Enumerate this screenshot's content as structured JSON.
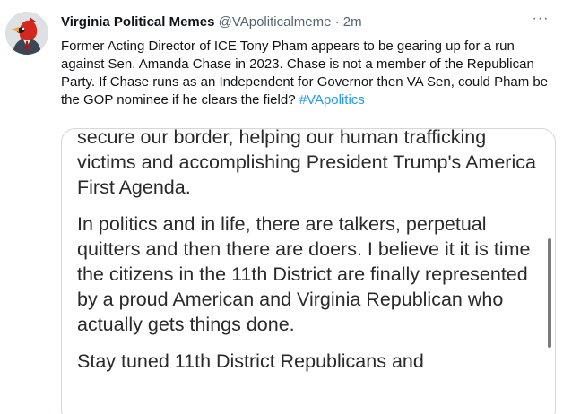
{
  "tweet": {
    "author_name": "Virginia Political Memes",
    "handle": "@VApoliticalmeme",
    "separator": "·",
    "timestamp": "2m",
    "more_label": "···",
    "text_main": "Former Acting Director of ICE Tony Pham appears to be gearing up for a run against Sen. Amanda Chase in 2023. Chase is not a member of the Republican Party. If Chase runs as an Independent for Governor then VA Sen, could Pham be the GOP nominee if he clears the field? ",
    "hashtag": "#VApolitics"
  },
  "media": {
    "paragraphs": [
      "secure our border, helping our human trafficking victims and accomplishing President Trump's America First Agenda.",
      "In politics and in life, there are talkers, perpetual quitters and then there are doers. I believe it it is time the citizens in the 11th District are finally represented by a proud American and Virginia Republican who actually gets things done.",
      "Stay tuned 11th District Republicans and"
    ]
  },
  "colors": {
    "text": "#0f1419",
    "secondary": "#536471",
    "link": "#1d9bf0",
    "border": "#cfd9de",
    "cardinal_red": "#d4271f"
  },
  "icons": {
    "avatar": "cardinal-avatar-icon",
    "more": "more-icon"
  }
}
